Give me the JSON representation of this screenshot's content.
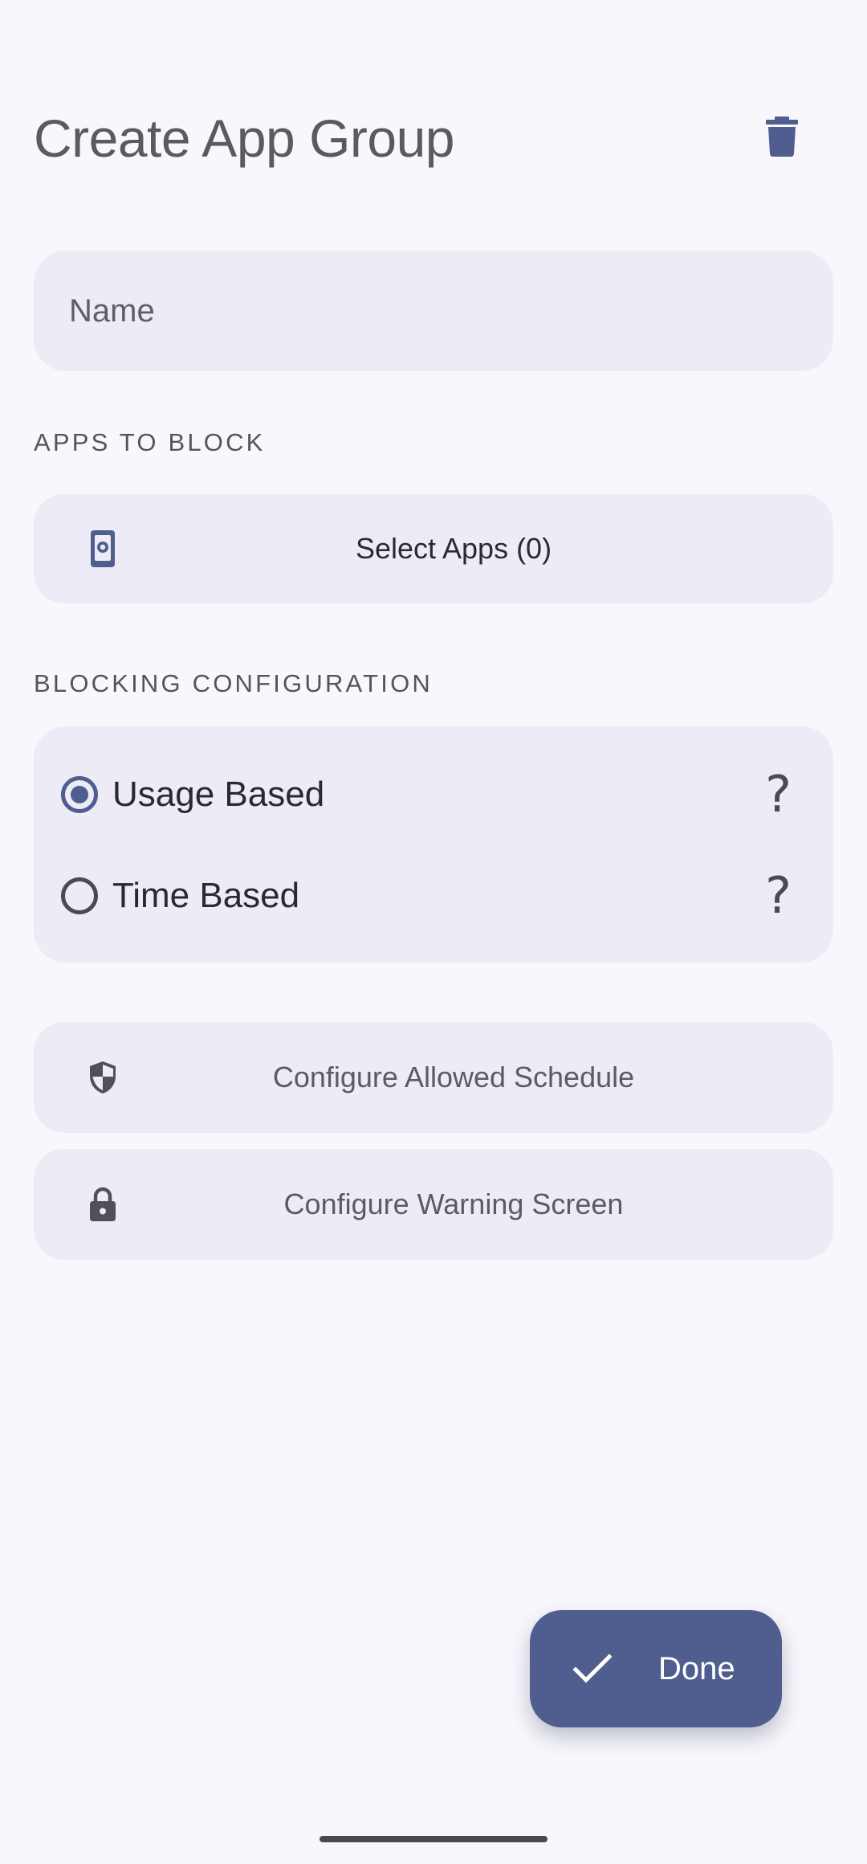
{
  "header": {
    "title": "Create App Group",
    "delete_icon": "trash-icon"
  },
  "name_field": {
    "placeholder": "Name",
    "value": ""
  },
  "apps_section": {
    "label": "APPS TO BLOCK",
    "select_button": {
      "icon": "phone-app-icon",
      "label": "Select Apps (0)"
    }
  },
  "blocking_section": {
    "label": "BLOCKING CONFIGURATION",
    "options": [
      {
        "label": "Usage Based",
        "selected": true,
        "help": "?"
      },
      {
        "label": "Time Based",
        "selected": false,
        "help": "?"
      }
    ]
  },
  "actions": {
    "allowed_schedule": {
      "icon": "shield-icon",
      "label": "Configure Allowed Schedule"
    },
    "warning_screen": {
      "icon": "lock-icon",
      "label": "Configure Warning Screen"
    }
  },
  "fab": {
    "icon": "check-icon",
    "label": "Done"
  },
  "colors": {
    "background": "#F7F7FC",
    "surface": "#EDEBF5",
    "accent": "#4F5E8E"
  }
}
